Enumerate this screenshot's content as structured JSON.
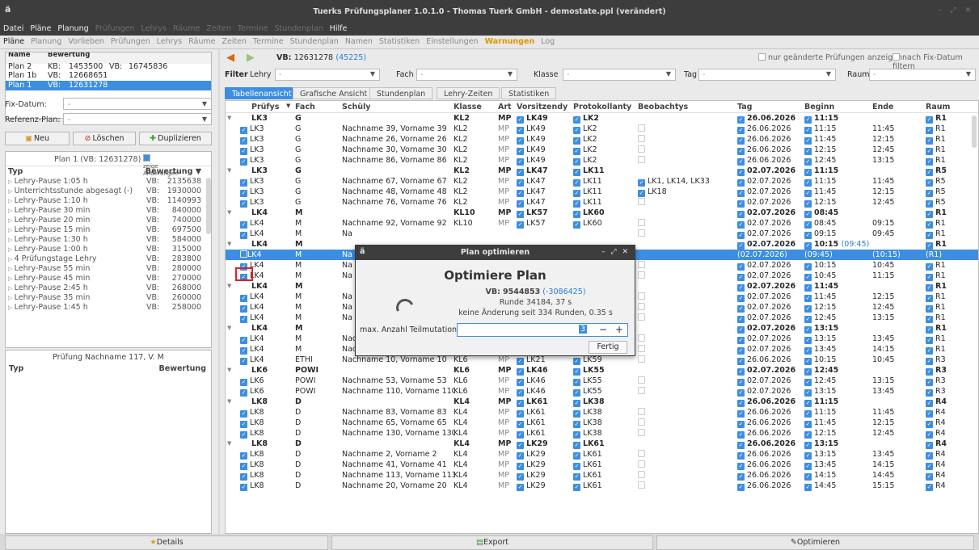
{
  "window": {
    "title": "Tuerks Prüfungsplaner 1.0.1.0 - Thomas Tuerk GmbH - demostate.ppl (verändert)",
    "logo": "ä"
  },
  "menu": [
    {
      "label": "Datei",
      "enabled": true
    },
    {
      "label": "Pläne",
      "enabled": true
    },
    {
      "label": "Planung",
      "enabled": true
    },
    {
      "label": "Prüfungen",
      "enabled": false
    },
    {
      "label": "Lehrys",
      "enabled": false
    },
    {
      "label": "Räume",
      "enabled": false
    },
    {
      "label": "Zeiten",
      "enabled": false
    },
    {
      "label": "Termine",
      "enabled": false
    },
    {
      "label": "Stundenplan",
      "enabled": false
    },
    {
      "label": "Hilfe",
      "enabled": true
    }
  ],
  "tabs": [
    {
      "label": "Pläne",
      "state": "active"
    },
    {
      "label": "Planung",
      "state": ""
    },
    {
      "label": "Vorlieben",
      "state": ""
    },
    {
      "label": "Prüfungen",
      "state": ""
    },
    {
      "label": "Lehrys",
      "state": ""
    },
    {
      "label": "Räume",
      "state": ""
    },
    {
      "label": "Zeiten",
      "state": ""
    },
    {
      "label": "Termine",
      "state": ""
    },
    {
      "label": "Stundenplan",
      "state": ""
    },
    {
      "label": "Namen",
      "state": ""
    },
    {
      "label": "Statistiken",
      "state": ""
    },
    {
      "label": "Einstellungen",
      "state": ""
    },
    {
      "label": "Warnungen",
      "state": "warn"
    },
    {
      "label": "Log",
      "state": ""
    }
  ],
  "plan_list": {
    "header_name": "Name",
    "header_score": "Bewertung",
    "rows": [
      {
        "name": "Plan 2",
        "k1": "KB:",
        "v1": "1453500",
        "k2": "VB:",
        "v2": "16745836",
        "selected": false
      },
      {
        "name": "Plan 1b",
        "k1": "VB:",
        "v1": "12668651",
        "k2": "",
        "v2": "",
        "selected": false
      },
      {
        "name": "Plan 1",
        "k1": "VB:",
        "v1": "12631278",
        "k2": "",
        "v2": "",
        "selected": true
      }
    ]
  },
  "fix_datum": {
    "label": "Fix-Datum:",
    "value": "-"
  },
  "referenz_plan": {
    "label": "Referenz-Plan:",
    "value": "-"
  },
  "buttons": {
    "neu": "Neu",
    "loeschen": "Löschen",
    "duplizieren": "Duplizieren"
  },
  "scores": {
    "title": "Plan 1 (VB: 12631278)",
    "show_changes": "zeige Änderungen",
    "col_type": "Typ",
    "col_score": "Bewertung",
    "rows": [
      {
        "type": "Lehry-Pause 1:05 h",
        "k": "VB:",
        "v": "2135638"
      },
      {
        "type": "Unterrichtsstunde abgesagt (-)",
        "k": "VB:",
        "v": "1930000"
      },
      {
        "type": "Lehry-Pause 1:10 h",
        "k": "VB:",
        "v": "1140993"
      },
      {
        "type": "Lehry-Pause 30 min",
        "k": "VB:",
        "v": "840000"
      },
      {
        "type": "Lehry-Pause 20 min",
        "k": "VB:",
        "v": "740000"
      },
      {
        "type": "Lehry-Pause 15 min",
        "k": "VB:",
        "v": "697500"
      },
      {
        "type": "Lehry-Pause 1:30 h",
        "k": "VB:",
        "v": "584000"
      },
      {
        "type": "Lehry-Pause 1:00 h",
        "k": "VB:",
        "v": "315000"
      },
      {
        "type": "4 Prüfungstage Lehry",
        "k": "VB:",
        "v": "283800"
      },
      {
        "type": "Lehry-Pause 55 min",
        "k": "VB:",
        "v": "280000"
      },
      {
        "type": "Lehry-Pause 45 min",
        "k": "VB:",
        "v": "270000"
      },
      {
        "type": "Lehry-Pause 2:45 h",
        "k": "VB:",
        "v": "268000"
      },
      {
        "type": "Lehry-Pause 35 min",
        "k": "VB:",
        "v": "260000"
      },
      {
        "type": "Lehry-Pause 1:45 h",
        "k": "VB:",
        "v": "258000"
      }
    ]
  },
  "detail": {
    "title": "Prüfung Nachname 117, V. M",
    "col_type": "Typ",
    "col_score": "Bewertung"
  },
  "toolbar": {
    "vb_label": "VB:",
    "vb_value": "12631278",
    "vb_delta": "(45225)",
    "opt1": "nur geänderte Prüfungen anzeigen",
    "opt2": "nach Fix-Datum filtern"
  },
  "filter": {
    "title": "Filter",
    "lehry_label": "Lehry",
    "lehry_value": "-",
    "fach_label": "Fach",
    "fach_value": "-",
    "klasse_label": "Klasse",
    "klasse_value": "-",
    "tag_label": "Tag",
    "tag_value": "-",
    "raum_label": "Raum",
    "raum_value": "-"
  },
  "view_tabs": [
    "Tabellenansicht",
    "Grafische Ansicht",
    "Stundenplan",
    "Lehry-Zeiten",
    "Statistiken"
  ],
  "table": {
    "headers": [
      "Prüfys",
      "Fach",
      "Schüly",
      "Klasse",
      "Art",
      "Vorsitzendy",
      "Protokollanty",
      "Beobachtys",
      "Tag",
      "Beginn",
      "Ende",
      "Raum"
    ],
    "rows": [
      {
        "g": true,
        "p": "LK3",
        "f": "G",
        "s": "",
        "k": "KL2",
        "a": "MP",
        "v": "LK49",
        "pr": "LK2",
        "b": "",
        "t": "26.06.2026",
        "be": "11:15",
        "e": "",
        "r": "R1"
      },
      {
        "p": "LK3",
        "f": "G",
        "s": "Nachname 39, Vorname 39",
        "k": "KL2",
        "a": "MP",
        "v": "LK49",
        "pr": "LK2",
        "b": "",
        "t": "26.06.2026",
        "be": "11:15",
        "e": "11:45",
        "r": "R1"
      },
      {
        "p": "LK3",
        "f": "G",
        "s": "Nachname 26, Vorname 26",
        "k": "KL2",
        "a": "MP",
        "v": "LK49",
        "pr": "LK2",
        "b": "",
        "t": "26.06.2026",
        "be": "11:45",
        "e": "12:15",
        "r": "R1"
      },
      {
        "p": "LK3",
        "f": "G",
        "s": "Nachname 30, Vorname 30",
        "k": "KL2",
        "a": "MP",
        "v": "LK49",
        "pr": "LK2",
        "b": "",
        "t": "26.06.2026",
        "be": "12:15",
        "e": "12:45",
        "r": "R1"
      },
      {
        "p": "LK3",
        "f": "G",
        "s": "Nachname 86, Vorname 86",
        "k": "KL2",
        "a": "MP",
        "v": "LK49",
        "pr": "LK2",
        "b": "",
        "t": "26.06.2026",
        "be": "12:45",
        "e": "13:15",
        "r": "R1"
      },
      {
        "g": true,
        "p": "LK3",
        "f": "G",
        "s": "",
        "k": "KL2",
        "a": "MP",
        "v": "LK47",
        "pr": "LK11",
        "b": "",
        "t": "02.07.2026",
        "be": "11:15",
        "e": "",
        "r": "R5"
      },
      {
        "p": "LK3",
        "f": "G",
        "s": "Nachname 67, Vorname 67",
        "k": "KL2",
        "a": "MP",
        "v": "LK47",
        "pr": "LK11",
        "b": "LK1, LK14, LK33",
        "t": "02.07.2026",
        "be": "11:15",
        "e": "11:45",
        "r": "R5"
      },
      {
        "p": "LK3",
        "f": "G",
        "s": "Nachname 48, Vorname 48",
        "k": "KL2",
        "a": "MP",
        "v": "LK47",
        "pr": "LK11",
        "b": "LK18",
        "t": "02.07.2026",
        "be": "11:45",
        "e": "12:15",
        "r": "R5"
      },
      {
        "p": "LK3",
        "f": "G",
        "s": "Nachname 76, Vorname 76",
        "k": "KL2",
        "a": "MP",
        "v": "LK47",
        "pr": "LK11",
        "b": "",
        "t": "02.07.2026",
        "be": "12:15",
        "e": "12:45",
        "r": "R5"
      },
      {
        "g": true,
        "p": "LK4",
        "f": "M",
        "s": "",
        "k": "KL10",
        "a": "MP",
        "v": "LK57",
        "pr": "LK60",
        "b": "",
        "t": "02.07.2026",
        "be": "08:45",
        "e": "",
        "r": "R1"
      },
      {
        "p": "LK4",
        "f": "M",
        "s": "Nachname 92, Vorname 92",
        "k": "KL10",
        "a": "MP",
        "v": "LK57",
        "pr": "LK60",
        "b": "",
        "t": "02.07.2026",
        "be": "08:45",
        "e": "09:15",
        "r": "R1"
      },
      {
        "p": "LK4",
        "f": "M",
        "s": "Na",
        "k": "",
        "a": "",
        "v": "",
        "pr": "",
        "b": "",
        "t": "02.07.2026",
        "be": "09:15",
        "e": "09:45",
        "r": "R1"
      },
      {
        "g": true,
        "p": "LK4",
        "f": "M",
        "s": "",
        "k": "",
        "a": "",
        "v": "",
        "pr": "",
        "b": "",
        "t": "02.07.2026",
        "be": "10:15",
        "be2": "(09:45)",
        "e": "",
        "r": "R1"
      },
      {
        "hl": true,
        "p": "LK4",
        "f": "M",
        "s": "Na",
        "k": "",
        "a": "",
        "v": "",
        "pr": "",
        "b": "",
        "t": "(02.07.2026)",
        "be": "(09:45)",
        "e": "(10:15)",
        "r": "(R1)"
      },
      {
        "p": "LK4",
        "f": "M",
        "s": "Na",
        "k": "",
        "a": "",
        "v": "",
        "pr": "",
        "b": "",
        "t": "02.07.2026",
        "be": "10:15",
        "e": "10:45",
        "r": "R1"
      },
      {
        "p": "LK4",
        "f": "M",
        "s": "Na",
        "k": "",
        "a": "",
        "v": "",
        "pr": "",
        "b": "",
        "t": "02.07.2026",
        "be": "10:45",
        "e": "11:15",
        "r": "R1"
      },
      {
        "g": true,
        "p": "LK4",
        "f": "M",
        "s": "",
        "k": "",
        "a": "",
        "v": "",
        "pr": "",
        "b": "",
        "t": "02.07.2026",
        "be": "11:45",
        "e": "",
        "r": "R1"
      },
      {
        "p": "LK4",
        "f": "M",
        "s": "Na",
        "k": "",
        "a": "",
        "v": "",
        "pr": "",
        "b": "",
        "t": "02.07.2026",
        "be": "11:45",
        "e": "12:15",
        "r": "R1"
      },
      {
        "p": "LK4",
        "f": "M",
        "s": "Na",
        "k": "",
        "a": "",
        "v": "",
        "pr": "",
        "b": "",
        "t": "02.07.2026",
        "be": "12:15",
        "e": "12:45",
        "r": "R1"
      },
      {
        "p": "LK4",
        "f": "M",
        "s": "Na",
        "k": "",
        "a": "",
        "v": "",
        "pr": "",
        "b": "",
        "t": "02.07.2026",
        "be": "12:45",
        "e": "13:15",
        "r": "R1"
      },
      {
        "g": true,
        "p": "LK4",
        "f": "M",
        "s": "",
        "k": "",
        "a": "",
        "v": "",
        "pr": "",
        "b": "",
        "t": "02.07.2026",
        "be": "13:15",
        "e": "",
        "r": "R1"
      },
      {
        "p": "LK4",
        "f": "M",
        "s": "Nachname 96, Vorname 96",
        "k": "KL3",
        "a": "MP",
        "v": "LK57",
        "pr": "LK32",
        "b": "",
        "t": "02.07.2026",
        "be": "13:15",
        "e": "13:45",
        "r": "R1"
      },
      {
        "p": "LK4",
        "f": "M",
        "s": "Nachname 7, Vorname 7",
        "k": "KL3",
        "a": "MP",
        "v": "LK57",
        "pr": "LK32",
        "b": "",
        "t": "02.07.2026",
        "be": "13:45",
        "e": "14:15",
        "r": "R1"
      },
      {
        "p": "LK4",
        "f": "ETHI",
        "s": "Nachname 10, Vorname 10",
        "k": "KL6",
        "a": "MP",
        "v": "LK21",
        "pr": "LK59",
        "b": "",
        "t": "26.06.2026",
        "be": "10:15",
        "e": "10:45",
        "r": "R3"
      },
      {
        "g": true,
        "p": "LK6",
        "f": "POWI",
        "s": "",
        "k": "KL6",
        "a": "MP",
        "v": "LK46",
        "pr": "LK55",
        "b": "",
        "t": "02.07.2026",
        "be": "12:45",
        "e": "",
        "r": "R3"
      },
      {
        "p": "LK6",
        "f": "POWI",
        "s": "Nachname 53, Vorname 53",
        "k": "KL6",
        "a": "MP",
        "v": "LK46",
        "pr": "LK55",
        "b": "",
        "t": "02.07.2026",
        "be": "12:45",
        "e": "13:15",
        "r": "R3"
      },
      {
        "p": "LK6",
        "f": "POWI",
        "s": "Nachname 110, Vorname 110",
        "k": "KL6",
        "a": "MP",
        "v": "LK46",
        "pr": "LK55",
        "b": "",
        "t": "02.07.2026",
        "be": "13:15",
        "e": "13:45",
        "r": "R3"
      },
      {
        "g": true,
        "p": "LK8",
        "f": "D",
        "s": "",
        "k": "KL4",
        "a": "MP",
        "v": "LK61",
        "pr": "LK38",
        "b": "",
        "t": "26.06.2026",
        "be": "11:15",
        "e": "",
        "r": "R4"
      },
      {
        "p": "LK8",
        "f": "D",
        "s": "Nachname 83, Vorname 83",
        "k": "KL4",
        "a": "MP",
        "v": "LK61",
        "pr": "LK38",
        "b": "",
        "t": "26.06.2026",
        "be": "11:15",
        "e": "11:45",
        "r": "R4"
      },
      {
        "p": "LK8",
        "f": "D",
        "s": "Nachname 65, Vorname 65",
        "k": "KL4",
        "a": "MP",
        "v": "LK61",
        "pr": "LK38",
        "b": "",
        "t": "26.06.2026",
        "be": "11:45",
        "e": "12:15",
        "r": "R4"
      },
      {
        "p": "LK8",
        "f": "D",
        "s": "Nachname 130, Vorname 130",
        "k": "KL4",
        "a": "MP",
        "v": "LK61",
        "pr": "LK38",
        "b": "",
        "t": "26.06.2026",
        "be": "12:15",
        "e": "12:45",
        "r": "R4"
      },
      {
        "g": true,
        "p": "LK8",
        "f": "D",
        "s": "",
        "k": "KL4",
        "a": "MP",
        "v": "LK29",
        "pr": "LK61",
        "b": "",
        "t": "26.06.2026",
        "be": "13:15",
        "e": "",
        "r": "R4"
      },
      {
        "p": "LK8",
        "f": "D",
        "s": "Nachname 2, Vorname 2",
        "k": "KL4",
        "a": "MP",
        "v": "LK29",
        "pr": "LK61",
        "b": "",
        "t": "26.06.2026",
        "be": "13:15",
        "e": "13:45",
        "r": "R4"
      },
      {
        "p": "LK8",
        "f": "D",
        "s": "Nachname 41, Vorname 41",
        "k": "KL4",
        "a": "MP",
        "v": "LK29",
        "pr": "LK61",
        "b": "",
        "t": "26.06.2026",
        "be": "13:45",
        "e": "14:15",
        "r": "R4"
      },
      {
        "p": "LK8",
        "f": "D",
        "s": "Nachname 113, Vorname 113",
        "k": "KL4",
        "a": "MP",
        "v": "LK29",
        "pr": "LK61",
        "b": "",
        "t": "26.06.2026",
        "be": "14:15",
        "e": "14:45",
        "r": "R4"
      },
      {
        "p": "LK8",
        "f": "D",
        "s": "Nachname 20, Vorname 20",
        "k": "KL4",
        "a": "MP",
        "v": "LK29",
        "pr": "LK61",
        "b": "",
        "t": "26.06.2026",
        "be": "14:45",
        "e": "15:15",
        "r": "R4"
      }
    ]
  },
  "dialog": {
    "title": "Plan optimieren",
    "heading": "Optimiere Plan",
    "vb_label": "VB:",
    "vb_value": "9544853",
    "vb_delta": "(-3086425)",
    "round": "Runde 34184, 37 s",
    "nochange": "keine Änderung seit 334 Runden,  0.35 s",
    "mut_label": "max. Anzahl Teilmutationen:",
    "mut_value": "3",
    "minus": "−",
    "plus": "+",
    "done": "Fertig"
  },
  "bottom": {
    "details": "Details",
    "export": "Export",
    "optimieren": "Optimieren"
  }
}
